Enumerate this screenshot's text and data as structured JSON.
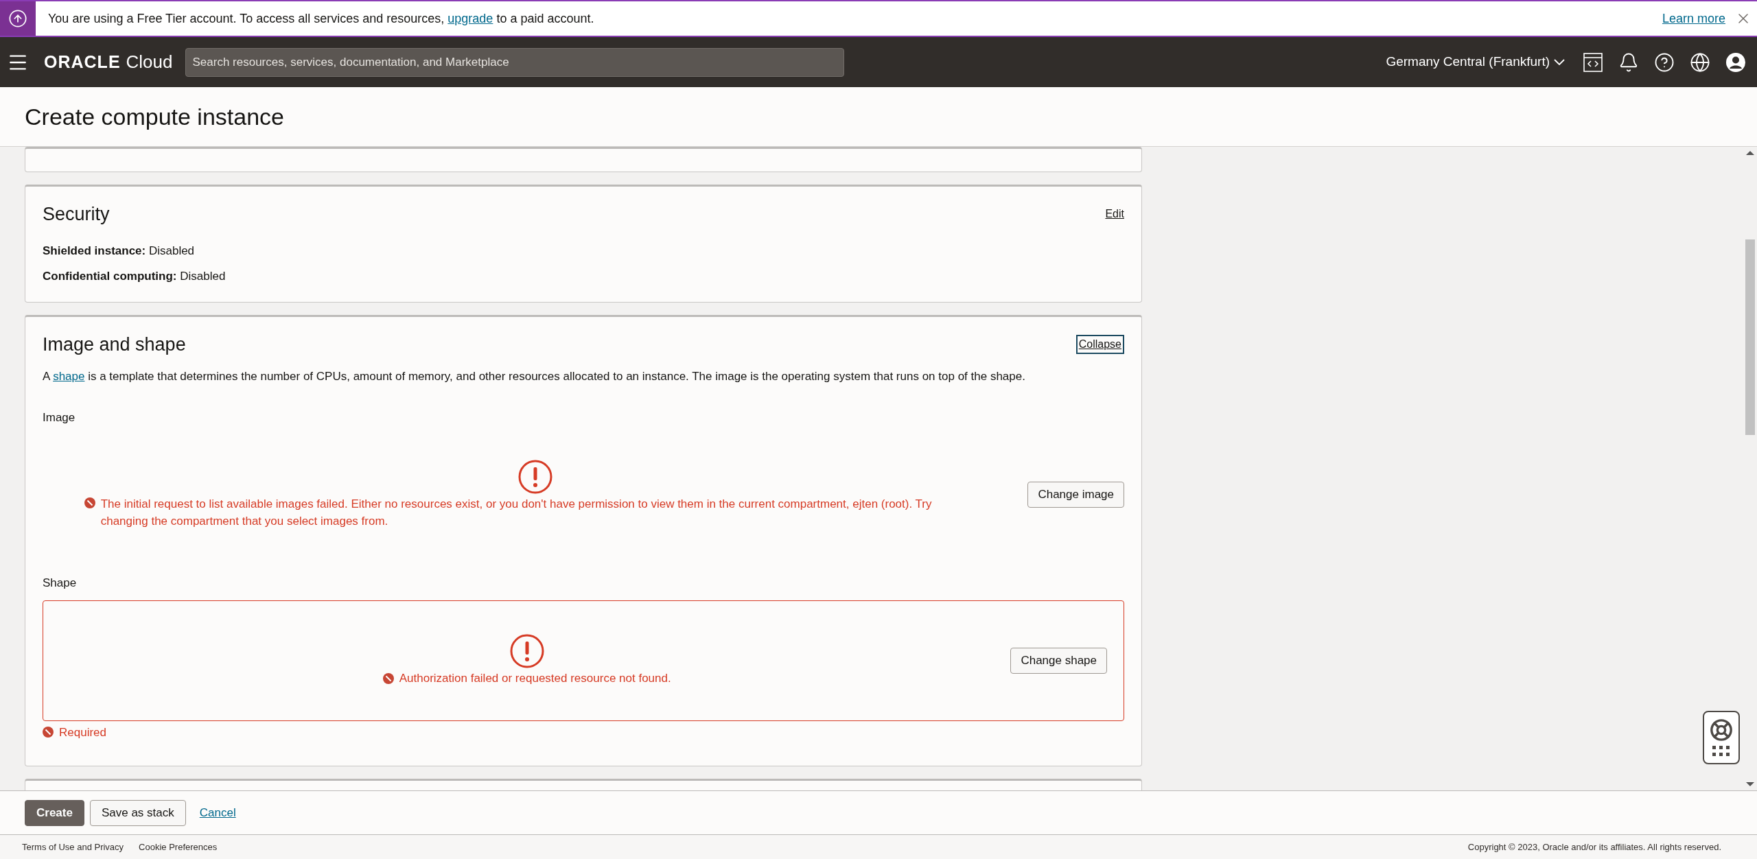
{
  "banner": {
    "text_before": "You are using a Free Tier account. To access all services and resources, ",
    "link": "upgrade",
    "text_after": " to a paid account.",
    "learn_more": "Learn more"
  },
  "header": {
    "brand": "ORACLE",
    "product": "Cloud",
    "search": {
      "placeholder": "Search resources, services, documentation, and Marketplace"
    },
    "region": "Germany Central (Frankfurt)"
  },
  "page_title": "Create compute instance",
  "security": {
    "title": "Security",
    "action": "Edit",
    "fields": [
      "**Shielded instance:** Disabled",
      "**Confidential computing:** Disabled"
    ]
  },
  "image_and_shape": {
    "title": "Image and shape",
    "action": "Collapse",
    "description_before": "A ",
    "description_link": "shape",
    "description_after": " is a template that determines the number of CPUs, amount of memory, and other resources allocated to an instance. The image is the operating system that runs on top of the shape.",
    "image": {
      "label": "Image",
      "error": "The initial request to list available images failed. Either no resources exist, or you don't have permission to view them in the current compartment, ejten (root). Try changing the compartment that you select images from.",
      "button": "Change image"
    },
    "shape": {
      "label": "Shape",
      "error": "Authorization failed or requested resource not found.",
      "button": "Change shape",
      "validation": "Required"
    }
  },
  "actions": [
    {
      "label": "Create",
      "kind": "primary"
    },
    {
      "label": "Save as stack",
      "kind": "secondary"
    },
    {
      "label": "Cancel",
      "kind": "link"
    }
  ],
  "footer": {
    "links": [
      "Terms of Use and Privacy",
      "Cookie Preferences"
    ],
    "copyright": "Copyright © 2023, Oracle and/or its affiliates. All rights reserved."
  }
}
